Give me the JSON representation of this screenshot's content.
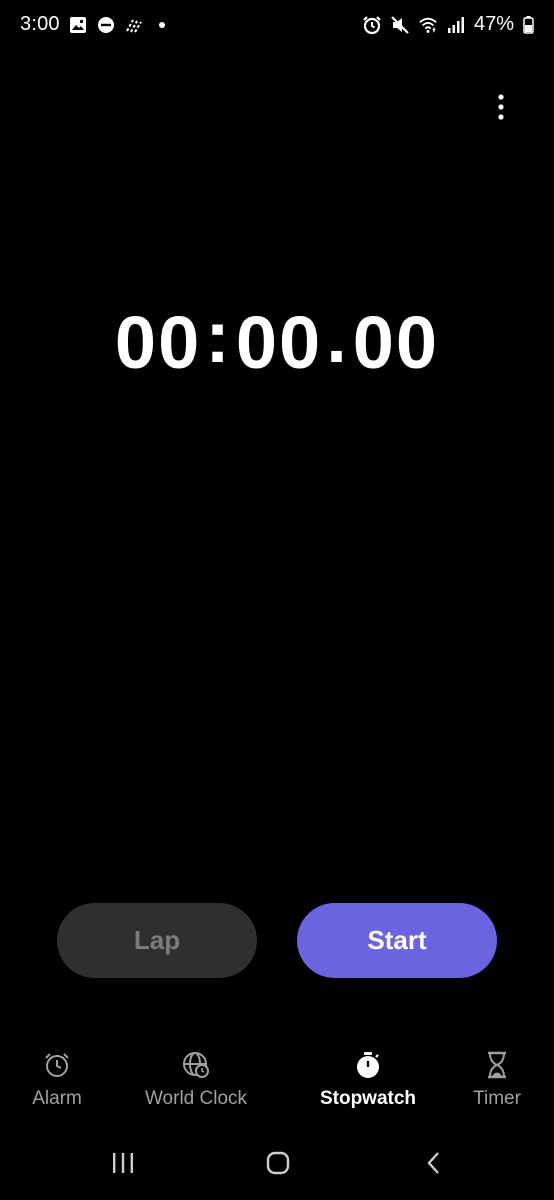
{
  "status_bar": {
    "time": "3:00",
    "battery_percent": "47%",
    "left_icons": [
      "image-icon",
      "do-not-disturb-icon",
      "data-saver-icon",
      "dot-icon"
    ],
    "right_icons": [
      "alarm-icon",
      "mute-icon",
      "wifi-icon",
      "signal-icon",
      "battery-icon"
    ]
  },
  "display": {
    "minutes": "00",
    "sep1": ":",
    "seconds": "00",
    "sep2": ".",
    "hundredths": "00"
  },
  "buttons": {
    "lap_label": "Lap",
    "start_label": "Start"
  },
  "tabs": [
    {
      "label": "Alarm",
      "icon": "alarm-clock-icon",
      "active": false
    },
    {
      "label": "World Clock",
      "icon": "globe-clock-icon",
      "active": false
    },
    {
      "label": "Stopwatch",
      "icon": "stopwatch-icon",
      "active": true
    },
    {
      "label": "Timer",
      "icon": "hourglass-icon",
      "active": false
    }
  ],
  "colors": {
    "background": "#000000",
    "start_button": "#6a64e0",
    "lap_button": "#2f2f31",
    "inactive_label": "#a0a0a3"
  },
  "system_nav": [
    "recents-icon",
    "home-icon",
    "back-icon"
  ]
}
